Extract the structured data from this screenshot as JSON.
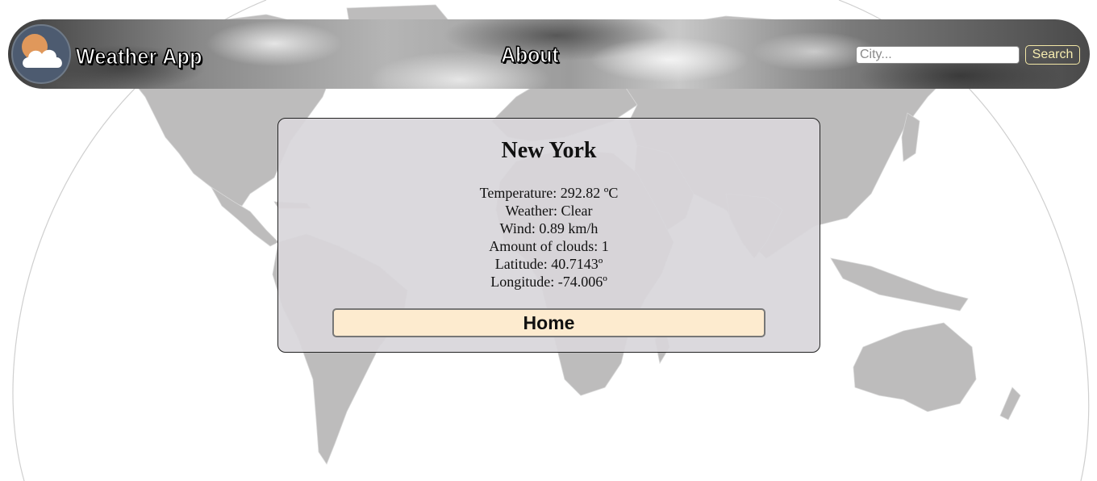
{
  "header": {
    "brand": "Weather App",
    "about_label": "About",
    "search_placeholder": "City...",
    "search_button_label": "Search",
    "logo_icon": "weather-cloud-sun-icon"
  },
  "card": {
    "city": "New York",
    "temperature": "Temperature: 292.82 ºC",
    "weather": "Weather: Clear",
    "wind": "Wind: 0.89 km/h",
    "clouds": "Amount of clouds: 1",
    "latitude": "Latitude: 40.7143º",
    "longitude": "Longitude: -74.006º",
    "home_button_label": "Home"
  },
  "background": {
    "icon": "world-map-icon"
  },
  "colors": {
    "map_land": "#bdbcbc",
    "card_bg": "#d8d6da",
    "home_button_bg": "#fdebcf",
    "search_button_text": "#f6ecb0"
  }
}
